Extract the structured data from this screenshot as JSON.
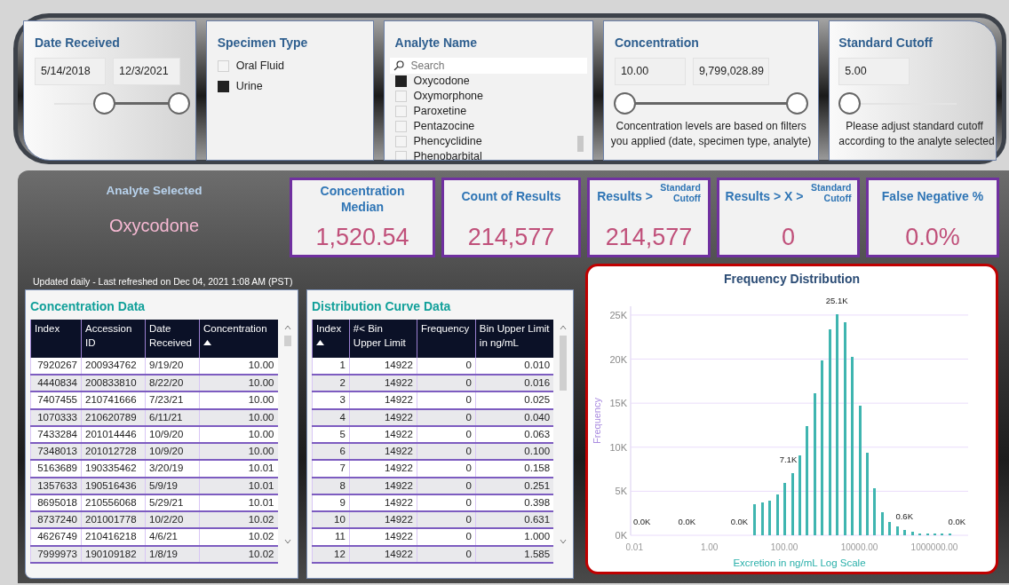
{
  "filters": {
    "date_received": {
      "title": "Date Received",
      "start": "5/14/2018",
      "end": "12/3/2021",
      "thumbs": [
        {
          "level": 0.4
        },
        {
          "level": 1
        }
      ]
    },
    "specimen_type": {
      "title": "Specimen Type",
      "items": [
        {
          "label": "Oral Fluid",
          "checked": false
        },
        {
          "label": "Urine",
          "checked": true
        }
      ]
    },
    "analyte_name": {
      "title": "Analyte Name",
      "search": {
        "placeholder": "Search"
      },
      "items": [
        {
          "label": "Oxycodone",
          "checked": true
        },
        {
          "label": "Oxymorphone",
          "checked": false
        },
        {
          "label": "Paroxetine",
          "checked": false
        },
        {
          "label": "Pentazocine",
          "checked": false
        },
        {
          "label": "Phencyclidine",
          "checked": false
        },
        {
          "label": "Phenobarbital",
          "checked": false
        }
      ]
    },
    "concentration": {
      "title": "Concentration",
      "min": "10.00",
      "max": "9,799,028.89",
      "thumbs": [
        {
          "level": 0
        },
        {
          "level": 1
        }
      ],
      "note_lines": [
        "Concentration levels are based on filters",
        "you applied (date, specimen type, analyte)"
      ]
    },
    "standard_cutoff": {
      "title": "Standard Cutoff",
      "value": "5.00",
      "level": 0,
      "note_lines": [
        "Please adjust standard cutoff",
        "according to the analyte selected"
      ]
    }
  },
  "analyte_selected": {
    "label": "Analyte Selected",
    "value": "Oxycodone"
  },
  "kpis": [
    {
      "label": "Concentration Median",
      "value": "1,520.54"
    },
    {
      "label": "Count of Results",
      "value": "214,577"
    },
    {
      "label": "Results >",
      "sublabel": "Standard Cutoff",
      "value": "214,577"
    },
    {
      "label": "Results > X >",
      "sublabel": "Standard Cutoff",
      "value": "0"
    },
    {
      "label": "False Negative %",
      "value": "0.0%"
    }
  ],
  "refresh_note": "Updated daily - Last refreshed on Dec 04, 2021 1:08 AM (PST)",
  "concentration_table": {
    "title": "Concentration Data",
    "columns": [
      {
        "label": "Index",
        "kind": "number",
        "sorted": false
      },
      {
        "label": "Accession ID",
        "kind": "text",
        "sorted": false
      },
      {
        "label": "Date Received",
        "kind": "text",
        "sorted": false
      },
      {
        "label": "Concentration",
        "kind": "number",
        "sorted": true
      }
    ],
    "rows": [
      [
        "7920267",
        "200934762",
        "9/19/20",
        "10.00"
      ],
      [
        "4440834",
        "200833810",
        "8/22/20",
        "10.00"
      ],
      [
        "7407455",
        "210741666",
        "7/23/21",
        "10.00"
      ],
      [
        "1070333",
        "210620789",
        "6/11/21",
        "10.00"
      ],
      [
        "7433284",
        "201014446",
        "10/9/20",
        "10.00"
      ],
      [
        "7348013",
        "201012728",
        "10/9/20",
        "10.00"
      ],
      [
        "5163689",
        "190335462",
        "3/20/19",
        "10.01"
      ],
      [
        "1357633",
        "190516436",
        "5/9/19",
        "10.01"
      ],
      [
        "8695018",
        "210556068",
        "5/29/21",
        "10.01"
      ],
      [
        "8737240",
        "201001778",
        "10/2/20",
        "10.02"
      ],
      [
        "4626749",
        "210416218",
        "4/6/21",
        "10.02"
      ],
      [
        "7999973",
        "190109182",
        "1/8/19",
        "10.02"
      ]
    ]
  },
  "distribution_table": {
    "title": "Distribution Curve Data",
    "columns": [
      {
        "label": "Index",
        "kind": "number",
        "sorted": true
      },
      {
        "label": "#< Bin Upper Limit",
        "kind": "number",
        "sorted": false
      },
      {
        "label": "Frequency",
        "kind": "number",
        "sorted": false
      },
      {
        "label": "Bin Upper Limit in ng/mL",
        "kind": "number",
        "sorted": false
      }
    ],
    "rows": [
      [
        "1",
        "14922",
        "0",
        "0.010"
      ],
      [
        "2",
        "14922",
        "0",
        "0.016"
      ],
      [
        "3",
        "14922",
        "0",
        "0.025"
      ],
      [
        "4",
        "14922",
        "0",
        "0.040"
      ],
      [
        "5",
        "14922",
        "0",
        "0.063"
      ],
      [
        "6",
        "14922",
        "0",
        "0.100"
      ],
      [
        "7",
        "14922",
        "0",
        "0.158"
      ],
      [
        "8",
        "14922",
        "0",
        "0.251"
      ],
      [
        "9",
        "14922",
        "0",
        "0.398"
      ],
      [
        "10",
        "14922",
        "0",
        "0.631"
      ],
      [
        "11",
        "14922",
        "0",
        "1.000"
      ],
      [
        "12",
        "14922",
        "0",
        "1.585"
      ]
    ]
  },
  "frequency_chart": {
    "chart_data": {
      "type": "bar",
      "title": "Frequency Distribution",
      "xlabel": "Excretion in ng/mL Log Scale",
      "ylabel": "Frequency",
      "categories": [
        "0.01",
        null,
        null,
        null,
        null,
        null,
        null,
        null,
        null,
        null,
        "1.00",
        null,
        null,
        null,
        null,
        null,
        null,
        null,
        null,
        null,
        "100.00",
        null,
        null,
        null,
        null,
        null,
        null,
        null,
        null,
        null,
        "10000.00",
        null,
        null,
        null,
        null,
        null,
        null,
        null,
        null,
        null,
        "1000000.00",
        null,
        null,
        null,
        null
      ],
      "values": [
        0,
        0,
        0,
        0,
        0,
        0,
        0,
        0,
        0,
        0,
        0,
        0,
        0,
        0,
        0,
        0,
        3500,
        3700,
        3900,
        4600,
        5900,
        7100,
        9100,
        12400,
        16100,
        19900,
        23400,
        25100,
        24200,
        20300,
        14700,
        9400,
        5300,
        2600,
        1500,
        1000,
        600,
        400,
        200,
        100,
        100,
        100,
        100,
        0,
        0
      ],
      "value_labels": [
        null,
        "0.0K",
        null,
        null,
        null,
        null,
        null,
        "0.0K",
        null,
        null,
        null,
        null,
        null,
        null,
        "0.0K",
        null,
        null,
        null,
        null,
        null,
        null,
        "7.1K",
        null,
        null,
        null,
        null,
        null,
        "25.1K",
        null,
        null,
        null,
        null,
        null,
        null,
        null,
        null,
        "0.6K",
        null,
        null,
        null,
        null,
        null,
        null,
        "0.0K",
        null
      ],
      "ylim": [
        0,
        26000
      ],
      "grid": true,
      "yticks": [
        {
          "value": 0,
          "label": "0K"
        },
        {
          "value": 5000,
          "label": "5K"
        },
        {
          "value": 10000,
          "label": "10K"
        },
        {
          "value": 15000,
          "label": "15K"
        },
        {
          "value": 20000,
          "label": "20K"
        },
        {
          "value": 25000,
          "label": "25K"
        }
      ]
    }
  }
}
